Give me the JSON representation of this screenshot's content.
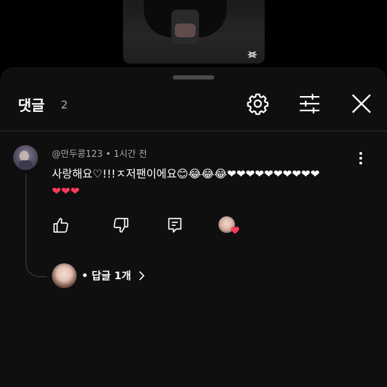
{
  "header": {
    "title": "댓글",
    "count": "2"
  },
  "comment": {
    "author": "@만두콩123",
    "time": "1시간 전",
    "text": "사랑해요♡!!!ㅈ저팬이에요😊😂😂😂❤️❤️❤️❤️❤️❤️❤️❤️❤️❤️❤️",
    "text_line1": "사랑해요♡!!!ㅈ저팬이에요😊😂😂😂❤❤❤❤❤❤❤❤❤❤",
    "text_line2": "❤❤❤"
  },
  "replies": {
    "label": "답글 1개",
    "bullet": "•"
  },
  "colors": {
    "heart": "#ff3b5c",
    "background": "#0f0f0f",
    "secondary_text": "#aaaaaa"
  },
  "icons": [
    "capcut-icon",
    "settings-gear-icon",
    "filter-sliders-icon",
    "close-icon",
    "more-vertical-icon",
    "like-thumb-up-icon",
    "dislike-thumb-down-icon",
    "reply-comment-icon",
    "creator-heart-badge"
  ]
}
